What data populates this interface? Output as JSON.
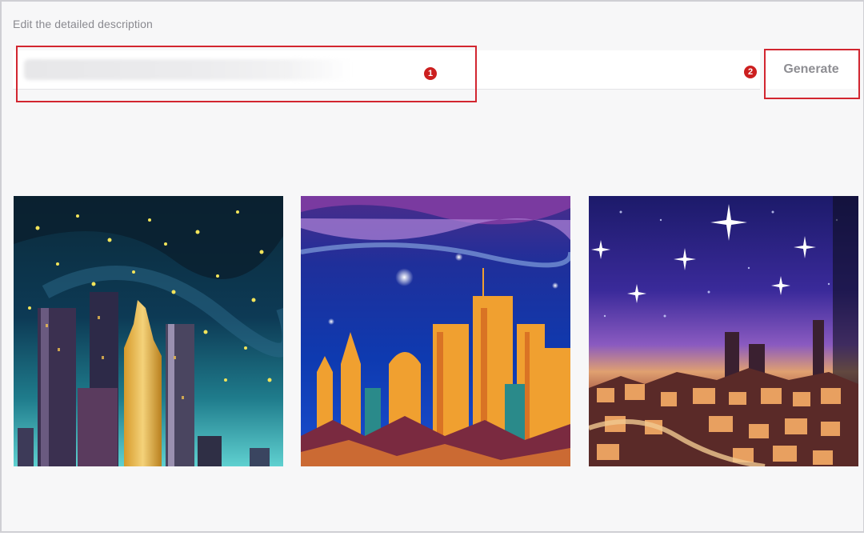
{
  "prompt": {
    "label": "Edit the detailed description",
    "value": ""
  },
  "actions": {
    "generate_label": "Generate"
  },
  "annotations": {
    "step1": "1",
    "step2": "2"
  },
  "results": [
    {
      "scene": "night-city-skyscrapers-painting"
    },
    {
      "scene": "starry-night-city-skyline-painting"
    },
    {
      "scene": "city-under-starry-sky-painting"
    }
  ],
  "colors": {
    "annotation_red": "#d22630",
    "button_text": "#8e8e93",
    "background": "#f7f7f8"
  }
}
